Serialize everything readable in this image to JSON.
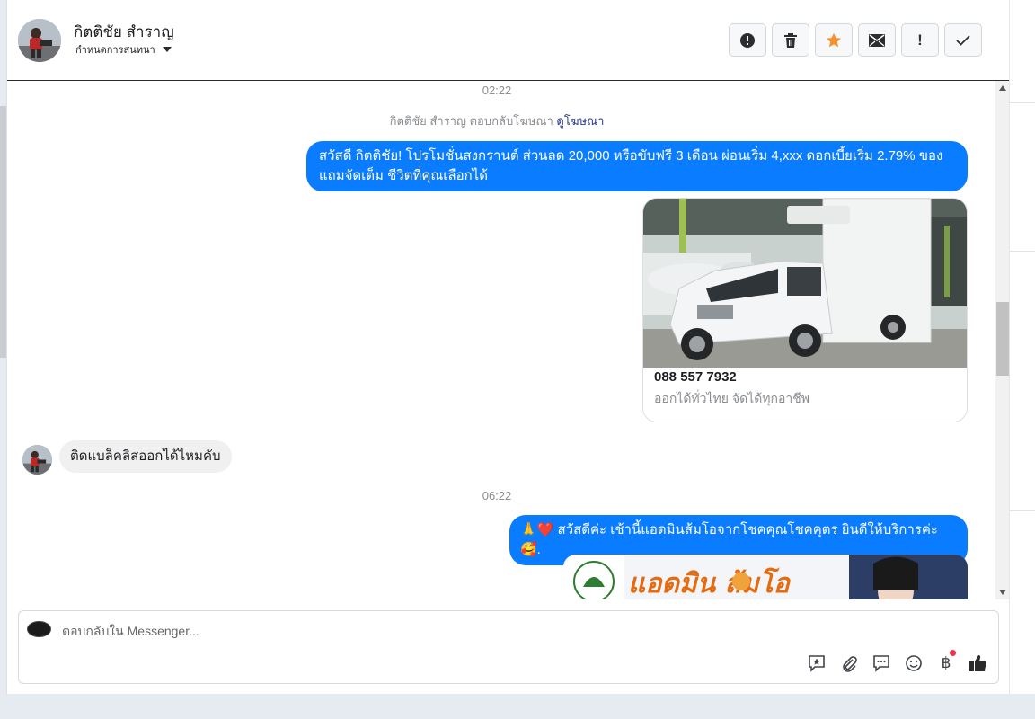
{
  "header": {
    "name": "กิตติชัย สำราญ",
    "subtitle": "กำหนดการสนทนา",
    "actions": [
      "report",
      "delete",
      "star",
      "mail",
      "important",
      "done"
    ],
    "important_label": "!",
    "star_color": "#f5922f"
  },
  "chat": {
    "time1": "02:22",
    "notice_text": "กิตติชัย สำราญ ตอบกลับโฆษณา",
    "notice_link": "ดูโฆษณา",
    "promo_line1": "สวัสดี กิตติชัย! โปรโมชั่นสงกรานต์ ส่วนลด 20,000 หรือขับฟรี 3 เดือน ผ่อนเริ่ม 4,xxx ดอกเบี้ยเริ่ม 2.79% ของ",
    "promo_line2": "แถมจัดเต็ม ชีวิตที่คุณเลือกได้",
    "card_phone": "088 557 7932",
    "card_desc": "ออกได้ทั่วไทย จัดได้ทุกอาชีพ",
    "incoming_text": "ติดแบล็คลิสออกได้ไหมคับ",
    "time2": "06:22",
    "reply_text": "🙏❤️ สวัสดีค่ะ เช้านี้แอดมินส้มโอจากโชคคุณโชคคุตร ยินดีให้บริการค่ะ 🥰.",
    "banner_text": "แอดมิน ส้มโอ",
    "bubble_color": "#0a7cff"
  },
  "composer": {
    "placeholder": "ตอบกลับใน Messenger...",
    "icons": [
      "saved-reply-icon",
      "attach-icon",
      "chat-icon",
      "emoji-icon",
      "baht-icon",
      "like-icon"
    ],
    "baht_label": "฿"
  }
}
